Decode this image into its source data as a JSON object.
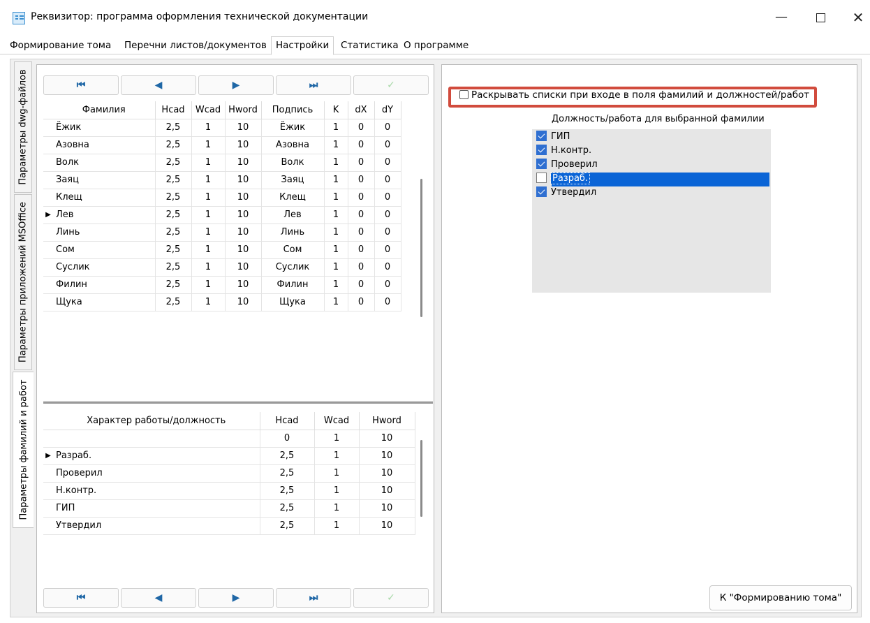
{
  "window": {
    "title": "Реквизитор: программа оформления технической документации",
    "minimize": "—",
    "close": "✕"
  },
  "tabs": [
    {
      "label": "Формирование тома",
      "active": false
    },
    {
      "label": "Перечни листов/документов",
      "active": false
    },
    {
      "label": "Настройки",
      "active": true
    },
    {
      "label": "Статистика",
      "active": false
    },
    {
      "label": "О программе",
      "active": false
    }
  ],
  "side_tabs": [
    {
      "label": "Параметры dwg-файлов",
      "active": false
    },
    {
      "label": "Параметры приложений MSOffice",
      "active": false
    },
    {
      "label": "Параметры фамилий и работ",
      "active": true
    }
  ],
  "navigator": {
    "first": "⏮",
    "prev": "◀",
    "next": "▶",
    "last": "⏭",
    "post": "✓"
  },
  "surnames_table": {
    "columns": [
      "Фамилия",
      "Hcad",
      "Wcad",
      "Hword",
      "Подпись",
      "K",
      "dX",
      "dY"
    ],
    "current_row": 5,
    "rows": [
      [
        "Ёжик",
        "2,5",
        "1",
        "10",
        "Ёжик",
        "1",
        "0",
        "0"
      ],
      [
        "Азовна",
        "2,5",
        "1",
        "10",
        "Азовна",
        "1",
        "0",
        "0"
      ],
      [
        "Волк",
        "2,5",
        "1",
        "10",
        "Волк",
        "1",
        "0",
        "0"
      ],
      [
        "Заяц",
        "2,5",
        "1",
        "10",
        "Заяц",
        "1",
        "0",
        "0"
      ],
      [
        "Клещ",
        "2,5",
        "1",
        "10",
        "Клещ",
        "1",
        "0",
        "0"
      ],
      [
        "Лев",
        "2,5",
        "1",
        "10",
        "Лев",
        "1",
        "0",
        "0"
      ],
      [
        "Линь",
        "2,5",
        "1",
        "10",
        "Линь",
        "1",
        "0",
        "0"
      ],
      [
        "Сом",
        "2,5",
        "1",
        "10",
        "Сом",
        "1",
        "0",
        "0"
      ],
      [
        "Суслик",
        "2,5",
        "1",
        "10",
        "Суслик",
        "1",
        "0",
        "0"
      ],
      [
        "Филин",
        "2,5",
        "1",
        "10",
        "Филин",
        "1",
        "0",
        "0"
      ],
      [
        "Щука",
        "2,5",
        "1",
        "10",
        "Щука",
        "1",
        "0",
        "0"
      ]
    ]
  },
  "roles_table": {
    "columns": [
      "Характер работы/должность",
      "Hcad",
      "Wcad",
      "Hword"
    ],
    "current_row": 1,
    "rows": [
      [
        "",
        "0",
        "1",
        "10"
      ],
      [
        "Разраб.",
        "2,5",
        "1",
        "10"
      ],
      [
        "Проверил",
        "2,5",
        "1",
        "10"
      ],
      [
        "Н.контр.",
        "2,5",
        "1",
        "10"
      ],
      [
        "ГИП",
        "2,5",
        "1",
        "10"
      ],
      [
        "Утвердил",
        "2,5",
        "1",
        "10"
      ]
    ]
  },
  "settings": {
    "expand_lists_label": "Раскрывать списки при входе в поля фамилий и должностей/работ",
    "expand_lists_checked": false,
    "highlight_color": "#d14b3d"
  },
  "roles_for_surname": {
    "title": "Должность/работа для выбранной фамилии",
    "items": [
      {
        "label": "ГИП",
        "checked": true
      },
      {
        "label": "Н.контр.",
        "checked": true
      },
      {
        "label": "Проверил",
        "checked": true
      },
      {
        "label": "Разраб.",
        "checked": false,
        "selected": true
      },
      {
        "label": "Утвердил",
        "checked": true
      }
    ],
    "selection_color": "#0a64d6"
  },
  "goto_button": "К \"Формированию тома\""
}
